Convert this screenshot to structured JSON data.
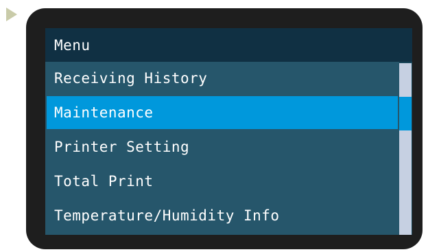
{
  "menu": {
    "title": "Menu",
    "items": [
      {
        "label": "Receiving History",
        "selected": false
      },
      {
        "label": "Maintenance",
        "selected": true
      },
      {
        "label": "Printer Setting",
        "selected": false
      },
      {
        "label": "Total Print",
        "selected": false
      },
      {
        "label": "Temperature/Humidity Info",
        "selected": false
      }
    ]
  },
  "colors": {
    "title_bar": "#103043",
    "list_background": "#26566b",
    "selection": "#0098dc",
    "scrollbar": "#c6d0e2",
    "bezel": "#1e1e1e",
    "pointer": "#c9cba9"
  },
  "icons": {
    "pointer": "play-triangle-icon"
  }
}
